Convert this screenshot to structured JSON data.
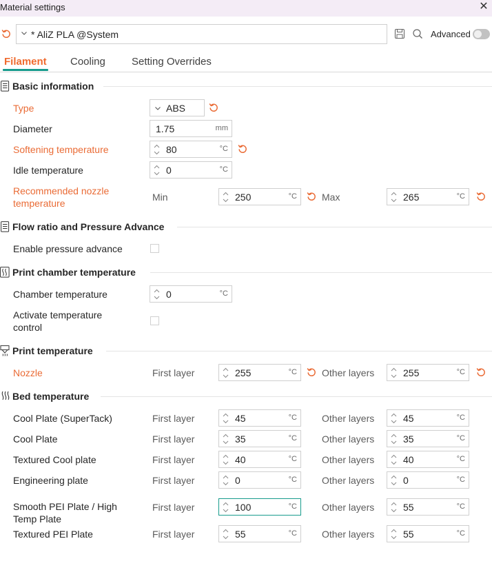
{
  "window": {
    "title": "Material settings"
  },
  "toolbar": {
    "preset_name": "* AliZ PLA @System",
    "advanced_label": "Advanced",
    "advanced_enabled": false
  },
  "tabs": [
    "Filament",
    "Cooling",
    "Setting Overrides"
  ],
  "sections": {
    "basic": "Basic information",
    "flow": "Flow ratio and Pressure Advance",
    "chamber": "Print chamber temperature",
    "print_temp": "Print temperature",
    "bed_temp": "Bed temperature"
  },
  "basic": {
    "type": {
      "label": "Type",
      "value": "ABS"
    },
    "diameter": {
      "label": "Diameter",
      "value": "1.75",
      "unit": "mm"
    },
    "softening": {
      "label": "Softening temperature",
      "value": "80",
      "unit": "°C"
    },
    "idle": {
      "label": "Idle temperature",
      "value": "0",
      "unit": "°C"
    },
    "nozzle_range": {
      "label_line1": "Recommended nozzle",
      "label_line2": "temperature",
      "min_label": "Min",
      "min_value": "250",
      "max_label": "Max",
      "max_value": "265",
      "unit": "°C"
    }
  },
  "flow": {
    "pressure_advance": {
      "label": "Enable pressure advance",
      "checked": false
    }
  },
  "chamber": {
    "temperature": {
      "label": "Chamber temperature",
      "value": "0",
      "unit": "°C"
    },
    "activate": {
      "label_line1": "Activate temperature",
      "label_line2": "control",
      "checked": false
    }
  },
  "print_temp": {
    "nozzle": {
      "label": "Nozzle",
      "first_label": "First layer",
      "first_value": "255",
      "other_label": "Other layers",
      "other_value": "255",
      "unit": "°C"
    }
  },
  "bed": {
    "first_label": "First layer",
    "other_label": "Other layers",
    "unit": "°C",
    "rows": [
      {
        "label_line1": "Cool Plate (SuperTack)",
        "label_line2": "",
        "first": "45",
        "other": "45"
      },
      {
        "label_line1": "Cool Plate",
        "label_line2": "",
        "first": "35",
        "other": "35"
      },
      {
        "label_line1": "Textured Cool plate",
        "label_line2": "",
        "first": "40",
        "other": "40"
      },
      {
        "label_line1": "Engineering plate",
        "label_line2": "",
        "first": "0",
        "other": "0"
      },
      {
        "label_line1": "Smooth PEI Plate / High",
        "label_line2": "Temp Plate",
        "first": "100",
        "other": "55"
      },
      {
        "label_line1": "Textured PEI Plate",
        "label_line2": "",
        "first": "55",
        "other": "55"
      }
    ]
  },
  "colors": {
    "accent": "#169b8c",
    "modified": "#ea6b35"
  }
}
